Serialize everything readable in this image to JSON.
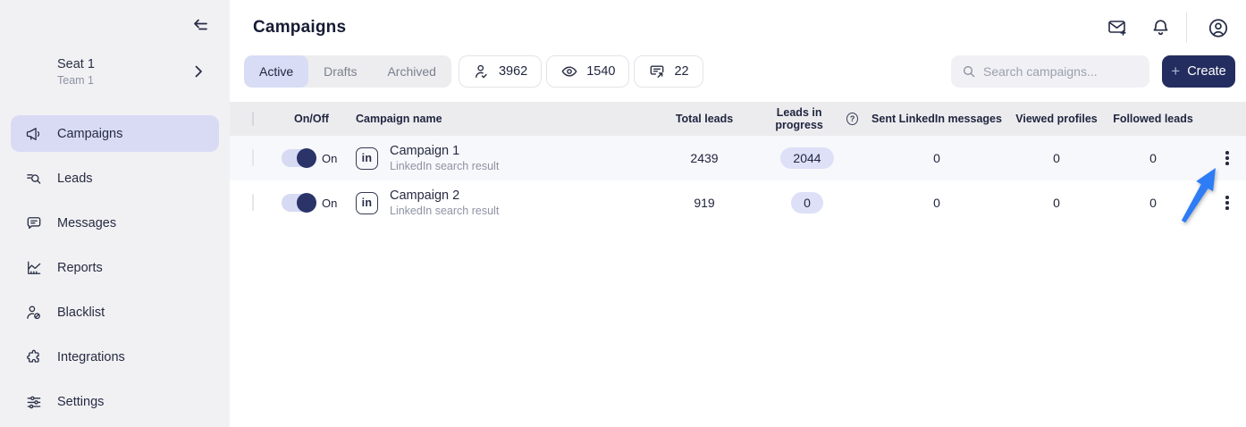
{
  "sidebar": {
    "seat": {
      "title": "Seat 1",
      "subtitle": "Team 1"
    },
    "items": [
      {
        "label": "Campaigns",
        "icon": "megaphone-icon",
        "active": true
      },
      {
        "label": "Leads",
        "icon": "lead-search-icon",
        "active": false
      },
      {
        "label": "Messages",
        "icon": "chat-bubble-icon",
        "active": false
      },
      {
        "label": "Reports",
        "icon": "chart-icon",
        "active": false
      },
      {
        "label": "Blacklist",
        "icon": "user-block-icon",
        "active": false
      },
      {
        "label": "Integrations",
        "icon": "puzzle-icon",
        "active": false
      },
      {
        "label": "Settings",
        "icon": "sliders-icon",
        "active": false
      }
    ]
  },
  "header": {
    "title": "Campaigns",
    "action_icons": [
      "mail-plus-icon",
      "bell-icon",
      "avatar-icon"
    ]
  },
  "toolbar": {
    "tabs": [
      {
        "label": "Active",
        "active": true
      },
      {
        "label": "Drafts",
        "active": false
      },
      {
        "label": "Archived",
        "active": false
      }
    ],
    "stats": [
      {
        "icon": "person-check-icon",
        "value": "3962"
      },
      {
        "icon": "eye-icon",
        "value": "1540"
      },
      {
        "icon": "message-out-icon",
        "value": "22"
      }
    ],
    "search": {
      "placeholder": "Search campaigns...",
      "value": ""
    },
    "create_label": "Create",
    "create_plus": "+"
  },
  "table": {
    "columns": [
      "On/Off",
      "Campaign name",
      "Total leads",
      "Leads in progress",
      "Sent LinkedIn messages",
      "Viewed profiles",
      "Followed leads"
    ],
    "leads_in_progress_help": "?",
    "linkedin_badge": "in",
    "rows": [
      {
        "toggle_state": "On",
        "name": "Campaign 1",
        "subtitle": "LinkedIn search result",
        "total_leads": "2439",
        "leads_in_progress": "2044",
        "sent_messages": "0",
        "viewed_profiles": "0",
        "followed_leads": "0"
      },
      {
        "toggle_state": "On",
        "name": "Campaign 2",
        "subtitle": "LinkedIn search result",
        "total_leads": "919",
        "leads_in_progress": "0",
        "sent_messages": "0",
        "viewed_profiles": "0",
        "followed_leads": "0"
      }
    ]
  },
  "annotation": {
    "arrow_target": "row-1-kebab-menu"
  },
  "colors": {
    "accent_navy": "#232d5f",
    "accent_lavender": "#d9dbf5",
    "badge_lavender": "#dee0f8",
    "sidebar_bg": "#f1f1f4",
    "table_header_bg": "#ececef",
    "row_shade_bg": "#f7f8fb",
    "arrow_blue": "#2e7cf6"
  }
}
